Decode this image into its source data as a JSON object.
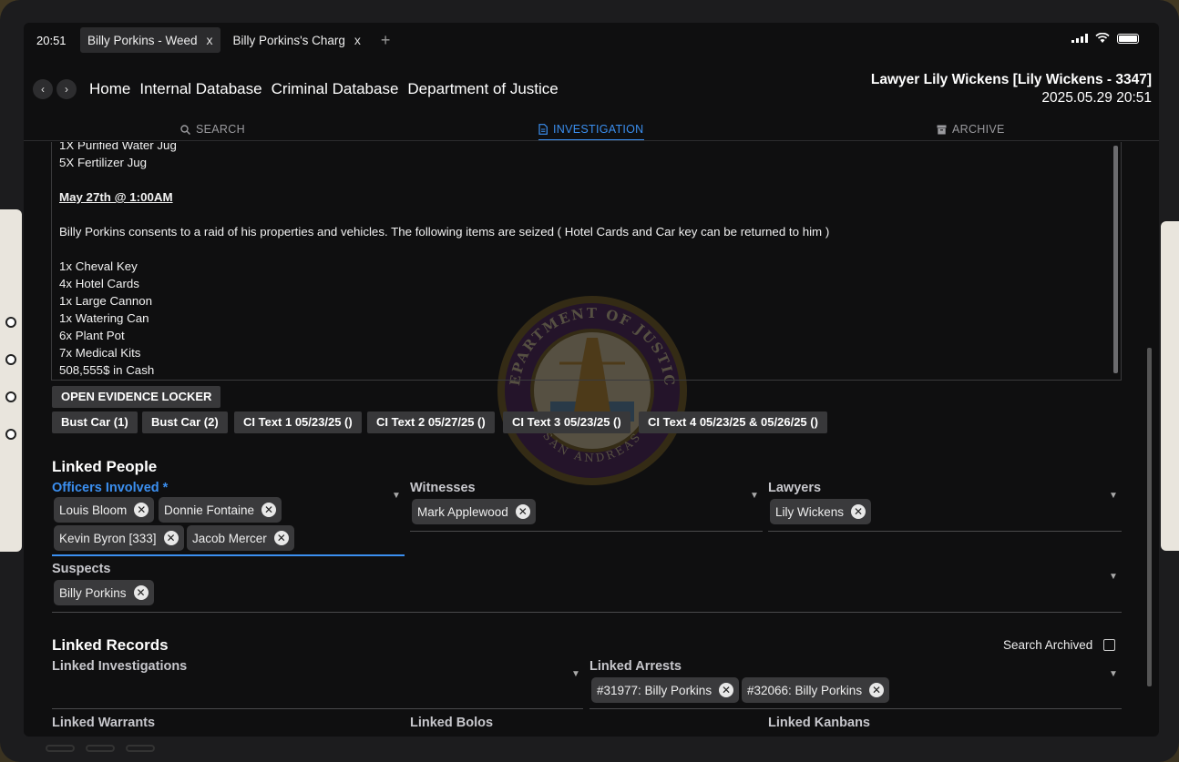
{
  "status": {
    "clock": "20:51"
  },
  "tabs": [
    {
      "label": "Billy Porkins - Weed",
      "close": "x"
    },
    {
      "label": "Billy Porkins's Charg",
      "close": "x"
    }
  ],
  "new_tab": "+",
  "nav": {
    "back": "‹",
    "forward": "›",
    "links": [
      "Home",
      "Internal Database",
      "Criminal Database",
      "Department of Justice"
    ]
  },
  "user": {
    "title": "Lawyer Lily Wickens [Lily Wickens - 3347]",
    "datetime": "2025.05.29 20:51"
  },
  "modes": [
    "SEARCH",
    "INVESTIGATION",
    "ARCHIVE"
  ],
  "notes": {
    "lines": [
      "1X Purified Water Jug",
      "5X Fertilizer Jug",
      "",
      "May 27th @ 1:00AM",
      "",
      "Billy Porkins consents to a raid of his properties and vehicles. The following items are seized ( Hotel Cards and Car key can be returned to him )",
      "",
      "1x Cheval Key",
      "4x Hotel Cards",
      "1x Large Cannon",
      "1x Watering Can",
      "6x Plant Pot",
      "7x Medical Kits",
      "508,555$ in Cash"
    ]
  },
  "evidence_button": "OPEN EVIDENCE LOCKER",
  "evidence_tags": [
    "Bust Car (1)",
    "Bust Car (2)",
    "CI Text 1 05/23/25 ()",
    "CI Text 2 05/27/25 ()",
    "CI Text 3 05/23/25 ()",
    "CI Text 4 05/23/25 & 05/26/25 ()"
  ],
  "linked_people": {
    "title": "Linked People",
    "officers_label": "Officers Involved *",
    "officers": [
      "Louis Bloom",
      "Donnie Fontaine",
      "Kevin Byron [333]",
      "Jacob Mercer"
    ],
    "witnesses_label": "Witnesses",
    "witnesses": [
      "Mark Applewood"
    ],
    "lawyers_label": "Lawyers",
    "lawyers": [
      "Lily Wickens"
    ],
    "suspects_label": "Suspects",
    "suspects": [
      "Billy Porkins"
    ]
  },
  "linked_records": {
    "title": "Linked Records",
    "search_archived": "Search Archived",
    "investigations_label": "Linked Investigations",
    "arrests_label": "Linked Arrests",
    "arrests": [
      "#31977: Billy Porkins",
      "#32066: Billy Porkins"
    ],
    "warrants_label": "Linked Warrants",
    "bolos_label": "Linked Bolos",
    "kanbans_label": "Linked Kanbans"
  },
  "seal": {
    "top_text": "DEPARTMENT OF JUSTICE",
    "bottom_text": "SAN ANDREAS"
  },
  "colors": {
    "accent": "#3b8ff0",
    "background": "#0f0f10",
    "chip": "#3a3a3c"
  }
}
